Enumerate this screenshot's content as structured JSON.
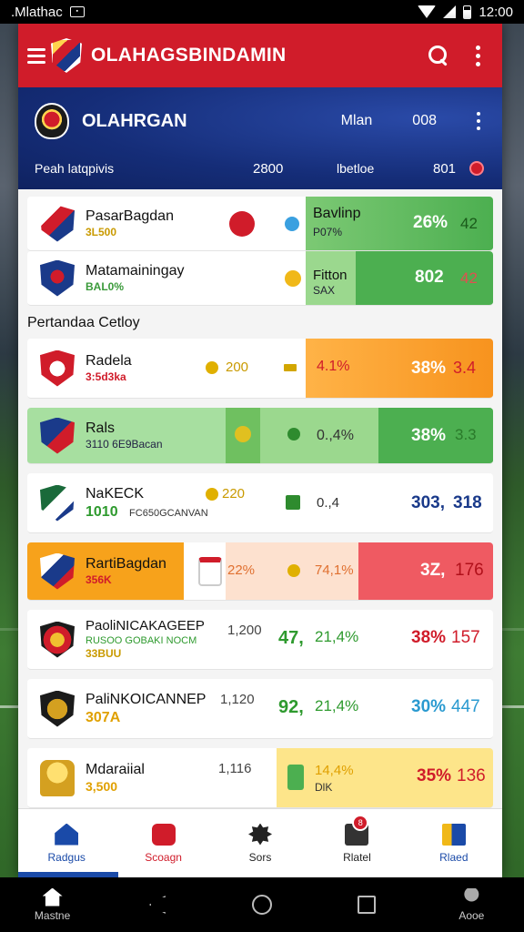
{
  "status_bar": {
    "carrier": ".Mlathac",
    "time": "12:00"
  },
  "header": {
    "title": "OLAHAGSBINDAMIN"
  },
  "team_banner": {
    "team_name": "OLAHRGAN",
    "meta_left": "Mlan",
    "meta_right": "008",
    "row2": {
      "label": "Peah latqpivis",
      "value1": "2800",
      "label2": "lbetloe",
      "value2": "801"
    }
  },
  "top_list": [
    {
      "name": "PasarBagdan",
      "sub": "3L500",
      "pct_label": "26%",
      "trend": "42",
      "panel_title": "Bavlinp",
      "panel_sub": "P07%"
    },
    {
      "name": "Matamainingay",
      "sub": "BAL0%",
      "pct_label": "802",
      "trend": "42",
      "panel_title": "Fitton",
      "panel_sub": "SAX"
    }
  ],
  "section_title": "Pertandaa Cetloy",
  "rows": [
    {
      "name": "Radela",
      "sub": "3:5d3ka",
      "num": "200",
      "mid": "4.1%",
      "pct": "38%",
      "trend": "3.4"
    },
    {
      "name": "Rals",
      "sub": "3110 6E9Bacan",
      "num": "",
      "mid": "0.,4%",
      "pct": "38%",
      "trend": "3.3"
    },
    {
      "name": "NaKECK",
      "sub": "1010",
      "sub2": "FC650GCANVAN",
      "num": "220",
      "mid": "0.,4",
      "pct": "303,",
      "trend": "318"
    },
    {
      "name": "RartiBagdan",
      "sub": "356K",
      "num": "",
      "mid": "22%",
      "mid2": "74,1%",
      "pct": "3Z,",
      "trend": "176"
    },
    {
      "name": "PaoliNICAKAGEEP",
      "sub": "RUSOO GOBAKI NOCM",
      "sub3": "33BUU",
      "num": "1,200",
      "mid": "47,",
      "mid2": "21,4%",
      "pct": "38%",
      "trend": "157"
    },
    {
      "name": "PaliNKOICANNEP",
      "sub": "307A",
      "num": "1,120",
      "mid": "92,",
      "mid2": "21,4%",
      "pct": "30%",
      "trend": "447"
    },
    {
      "name": "Mdaraiial",
      "sub": "3,500",
      "num": "1,116",
      "mid": "14,4%",
      "mid_sub": "DlK",
      "pct": "35%",
      "trend": "136"
    }
  ],
  "bottom_nav": [
    {
      "label": "Radgus",
      "icon": "home-wifi-icon"
    },
    {
      "label": "Scoagn",
      "icon": "play-icon"
    },
    {
      "label": "Sors",
      "icon": "gear-icon"
    },
    {
      "label": "Rlatel",
      "icon": "news-icon",
      "badge": "8"
    },
    {
      "label": "Rlaed",
      "icon": "book-icon"
    }
  ],
  "system_nav": {
    "home_label": "Mastne",
    "profile_label": "Aooe"
  },
  "colors": {
    "red": "#d01c2a",
    "navy": "#152d78",
    "green": "#4caf50",
    "orange": "#f7a21b"
  }
}
